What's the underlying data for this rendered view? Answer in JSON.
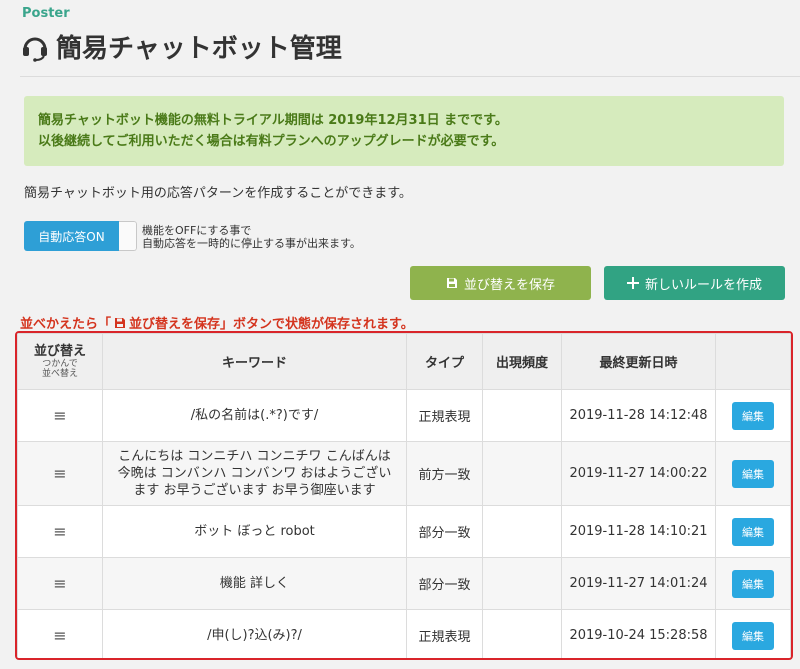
{
  "brand": "Poster",
  "page_title": "簡易チャットボット管理",
  "notice": {
    "line1": "簡易チャットボット機能の無料トライアル期間は 2019年12月31日 までです。",
    "line2": "以後継続してご利用いただく場合は有料プランへのアップグレードが必要です。"
  },
  "description": "簡易チャットボット用の応答パターンを作成することができます。",
  "toggle": {
    "label": "自動応答ON",
    "help_line1": "機能をOFFにする事で",
    "help_line2": "自動応答を一時的に停止する事が出来ます。"
  },
  "buttons": {
    "save_label": "並び替えを保存",
    "new_label": "新しいルールを作成"
  },
  "warning": {
    "prefix": "並べかえたら「",
    "button_name": "並び替えを保存",
    "suffix": "」ボタンで状態が保存されます。"
  },
  "table": {
    "headers": {
      "sort": "並び替え",
      "sort_sub1": "つかんで",
      "sort_sub2": "並べ替え",
      "keyword": "キーワード",
      "type": "タイプ",
      "frequency": "出現頻度",
      "updated": "最終更新日時"
    },
    "handle_glyph": "≡",
    "edit_label": "編集",
    "rows": [
      {
        "keyword": "/私の名前は(.*?)です/",
        "type": "正規表現",
        "frequency": "",
        "updated": "2019-11-28 14:12:48"
      },
      {
        "keyword": "こんにちは コンニチハ コンニチワ こんばんは 今晩は コンバンハ コンバンワ おはようござい ます お早うございます お早う御座います",
        "type": "前方一致",
        "frequency": "",
        "updated": "2019-11-27 14:00:22"
      },
      {
        "keyword": "ボット ぼっと robot",
        "type": "部分一致",
        "frequency": "",
        "updated": "2019-11-28 14:10:21"
      },
      {
        "keyword": "機能 詳しく",
        "type": "部分一致",
        "frequency": "",
        "updated": "2019-11-27 14:01:24"
      },
      {
        "keyword": "/申(し)?込(み)?/",
        "type": "正規表現",
        "frequency": "",
        "updated": "2019-10-24 15:28:58"
      }
    ]
  },
  "colors": {
    "accent": "#31a383",
    "notice_bg": "#d6ebbd",
    "notice_text": "#4a7a18",
    "warning": "#d4341e",
    "toggle_on": "#2e9fd6",
    "save_button": "#8fb34d",
    "edit_button": "#2aa8e0",
    "highlight_border": "#d9242a"
  },
  "icons": {
    "title": "headset-icon",
    "save": "floppy-disk-icon",
    "new": "plus-icon",
    "row_handle": "drag-handle-icon"
  }
}
